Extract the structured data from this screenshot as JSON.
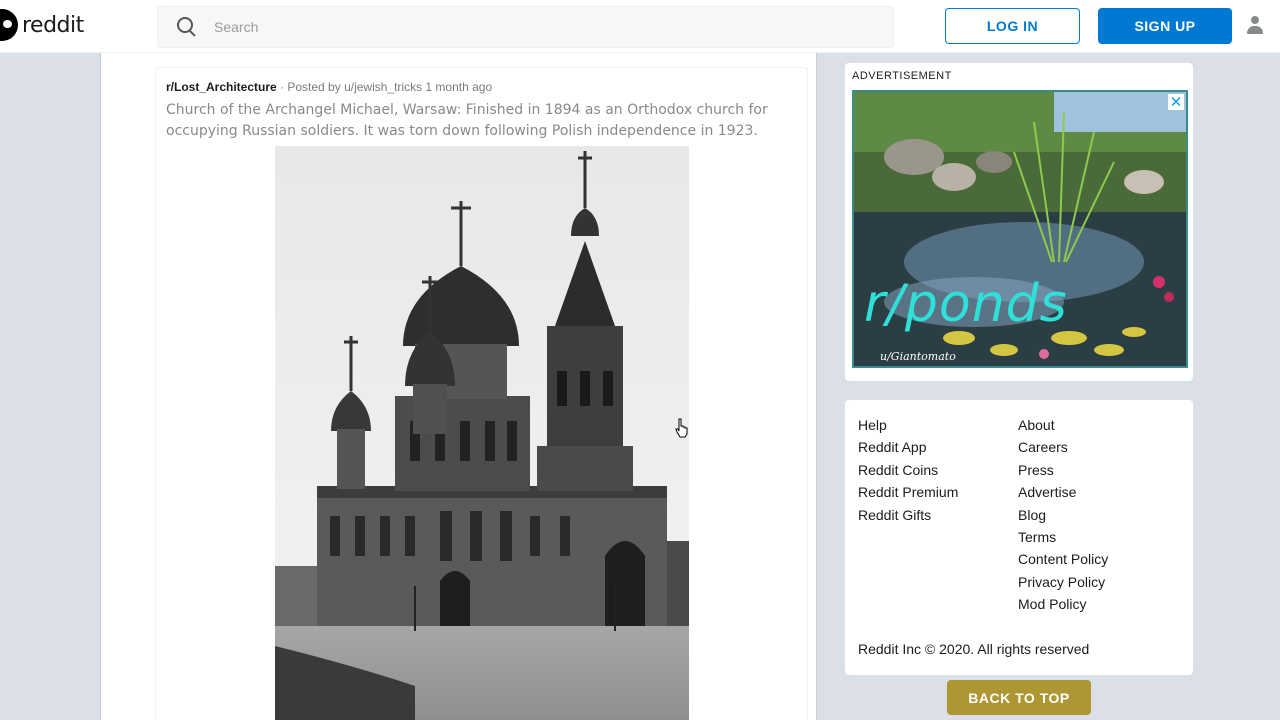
{
  "header": {
    "logo_text": "reddit",
    "search_placeholder": "Search",
    "login_label": "LOG IN",
    "signup_label": "SIGN UP"
  },
  "post": {
    "subreddit": "r/Lost_Architecture",
    "meta": " · Posted by u/jewish_tricks 1 month ago",
    "title": "Church of the Archangel Michael, Warsaw: Finished in 1894 as an Orthodox church for occupying Russian soldiers. It was torn down following Polish independence in 1923.",
    "image_alt": "Black and white photo of an Orthodox church with onion domes"
  },
  "ad": {
    "label": "ADVERTISEMENT",
    "close": "✕",
    "text": "r/ponds",
    "credit": "u/Giantomato"
  },
  "footer_links": {
    "left": [
      "Help",
      "Reddit App",
      "Reddit Coins",
      "Reddit Premium",
      "Reddit Gifts"
    ],
    "right": [
      "About",
      "Careers",
      "Press",
      "Advertise",
      "Blog",
      "Terms",
      "Content Policy",
      "Privacy Policy",
      "Mod Policy"
    ],
    "copyright": "Reddit Inc © 2020. All rights reserved"
  },
  "back_to_top_label": "BACK TO TOP",
  "colors": {
    "primary_blue": "#0079d3",
    "back_to_top_gold": "#ae9633",
    "page_bg": "#dae0e6"
  }
}
